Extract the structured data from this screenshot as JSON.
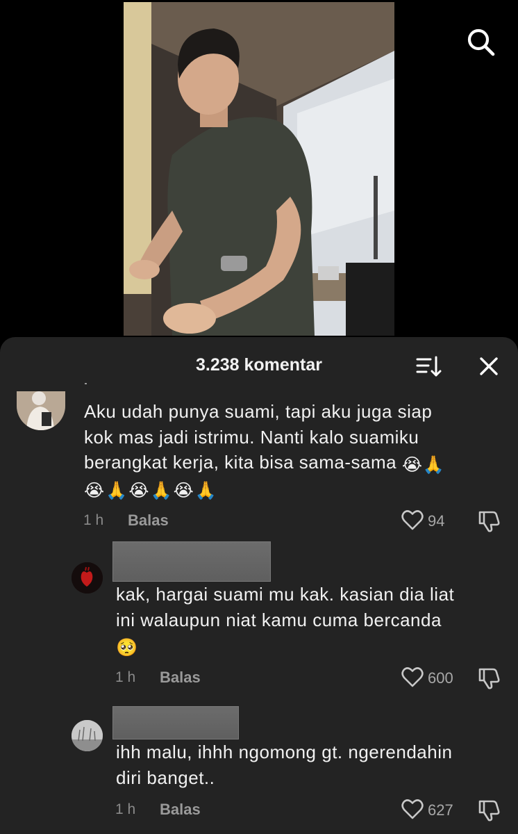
{
  "header": {
    "comment_count": "3.238 komentar"
  },
  "icons": {
    "search": "search-icon",
    "sort": "sort-icon",
    "close": "close-icon",
    "like": "heart-icon",
    "dislike": "thumbs-down-icon"
  },
  "comments": [
    {
      "text_line1": "Aku udah punya suami, tapi aku juga siap",
      "text_line2": "kok mas jadi istrimu. Nanti kalo suamiku",
      "text_line3": "berangkat kerja, kita bisa sama-sama",
      "emojis_inline": "😭🙏",
      "emojis_line4": "😭🙏😭🙏😭🙏",
      "time": "1 h",
      "reply_label": "Balas",
      "likes": "94"
    },
    {
      "text_line1": "kak, hargai suami mu kak. kasian dia liat",
      "text_line2": "ini walaupun niat kamu cuma bercanda",
      "emojis_line3": "🥺",
      "time": "1 h",
      "reply_label": "Balas",
      "likes": "600"
    },
    {
      "text_line1": "ihh malu, ihhh ngomong gt. ngerendahin",
      "text_line2": "diri banget..",
      "time": "1 h",
      "reply_label": "Balas",
      "likes": "627"
    }
  ],
  "colors": {
    "sheet_background": "#232323",
    "text_primary": "#f1f1f1",
    "text_secondary": "#8a8a8a"
  }
}
